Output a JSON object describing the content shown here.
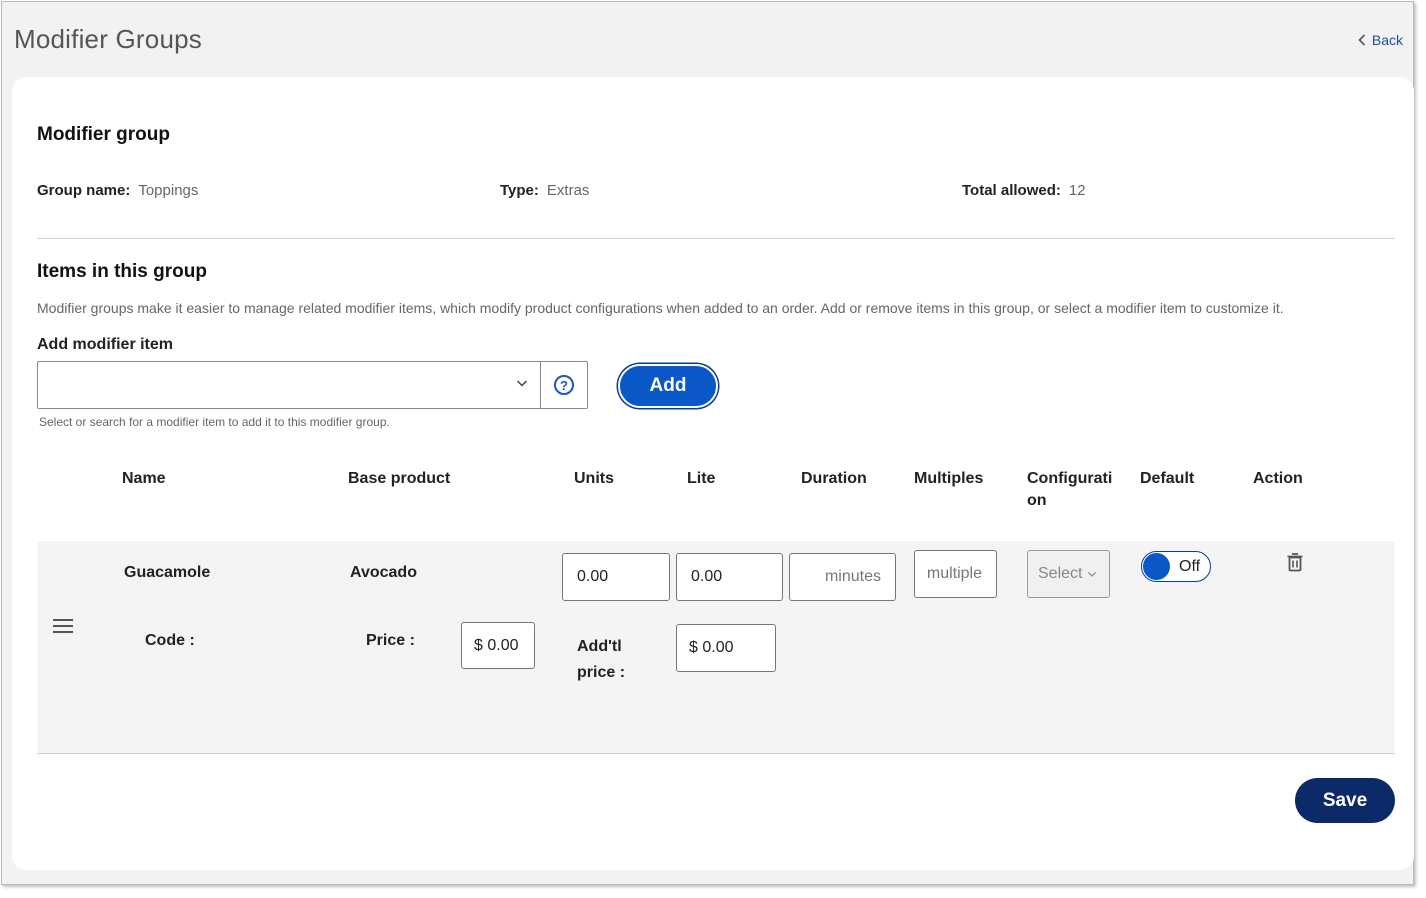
{
  "header": {
    "title": "Modifier Groups",
    "back_label": "Back"
  },
  "group": {
    "section_title": "Modifier group",
    "name_label": "Group name:",
    "name_value": "Toppings",
    "type_label": "Type:",
    "type_value": "Extras",
    "total_label": "Total allowed:",
    "total_value": "12"
  },
  "items": {
    "section_title": "Items in this group",
    "description": "Modifier groups make it easier to manage related modifier items, which modify product configurations when added to an order. Add or remove items in this group, or select a modifier item to customize it.",
    "add_label": "Add modifier item",
    "add_input_value": "",
    "help_icon": "?",
    "hint": "Select or search for a modifier item to add it to this modifier group.",
    "add_button": "Add"
  },
  "table": {
    "headers": [
      "Name",
      "Base product",
      "Units",
      "Lite",
      "Duration",
      "Multiples",
      "Configurati on",
      "Default",
      "Action"
    ],
    "header_configuration_line1": "Configurati",
    "header_configuration_line2": "on",
    "rows": [
      {
        "name": "Guacamole",
        "base_product": "Avocado",
        "units": "0.00",
        "lite": "0.00",
        "duration_placeholder": "minutes",
        "multiples_placeholder": "multiple",
        "configuration_placeholder": "Select",
        "default_toggle": "Off",
        "code_label": "Code :",
        "price_label": "Price :",
        "price_value": "$ 0.00",
        "addtl_label_line1": "Add'tl",
        "addtl_label_line2": "price :",
        "addtl_value": "$ 0.00"
      }
    ]
  },
  "footer": {
    "save_label": "Save"
  },
  "colors": {
    "accent": "#0a57c8",
    "save": "#0d2a68",
    "link": "#1a4f9c"
  }
}
